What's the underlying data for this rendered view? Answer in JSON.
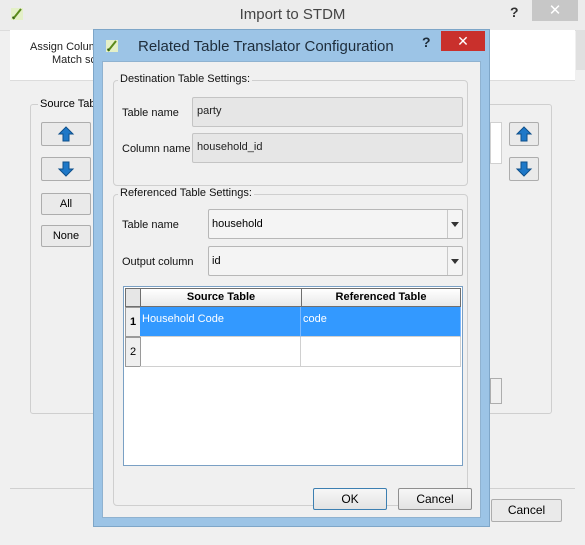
{
  "background_window": {
    "title": "Import to STDM",
    "help_symbol": "?",
    "close_symbol": "✕",
    "assign_text": "Assign Colum",
    "match_text": "Match sc",
    "source_group_label": "Source Tab",
    "buttons": {
      "all": "All",
      "none": "None",
      "cancel": "Cancel"
    }
  },
  "dialog": {
    "title": "Related Table Translator Configuration",
    "help_symbol": "?",
    "close_symbol": "✕",
    "destination": {
      "group_label": "Destination Table Settings:",
      "table_name_label": "Table name",
      "table_name_value": "party",
      "column_name_label": "Column name",
      "column_name_value": "household_id"
    },
    "referenced": {
      "group_label": "Referenced Table Settings:",
      "table_name_label": "Table name",
      "table_name_value": "household",
      "output_column_label": "Output column",
      "output_column_value": "id"
    },
    "table": {
      "columns": [
        "Source Table",
        "Referenced Table"
      ],
      "rows": [
        {
          "num": "1",
          "source": "Household Code",
          "referenced": "code",
          "selected": true
        },
        {
          "num": "2",
          "source": "",
          "referenced": "",
          "selected": false
        }
      ]
    },
    "buttons": {
      "ok": "OK",
      "cancel": "Cancel"
    }
  },
  "icons": {
    "app_icon": "qgis-brush-icon",
    "up_arrow": "arrow-up-icon",
    "down_arrow": "arrow-down-icon",
    "accent_blue": "#3399ff",
    "arrow_blue": "#1e78c8"
  }
}
